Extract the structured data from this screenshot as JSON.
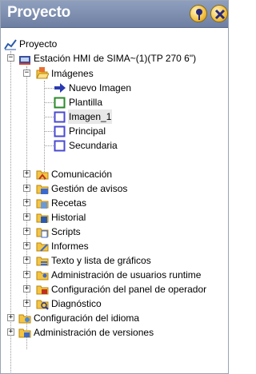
{
  "window": {
    "title": "Proyecto"
  },
  "tree": {
    "root": "Proyecto",
    "station": "Estación HMI de SIMA~(1)(TP 270 6\")",
    "images_folder": "Imágenes",
    "images": [
      "Nuevo Imagen",
      "Plantilla",
      "Imagen_1",
      "Principal",
      "Secundaria"
    ],
    "station_items": [
      "Comunicación",
      "Gestión de avisos",
      "Recetas",
      "Historial",
      "Scripts",
      "Informes",
      "Texto y lista de gráficos",
      "Administración de usuarios runtime",
      "Configuración del panel de operador",
      "Diagnóstico"
    ],
    "bottom_items": [
      "Configuración del idioma",
      "Administración de versiones"
    ]
  },
  "colors": {
    "title_bar": "#7b8cac",
    "folder": "#f5c542",
    "selection": "#e8e8e8"
  }
}
